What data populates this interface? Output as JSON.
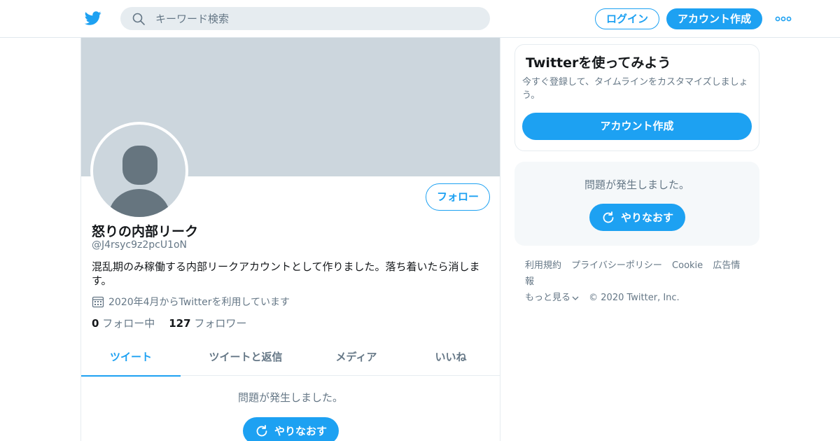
{
  "header": {
    "search_placeholder": "キーワード検索",
    "login_label": "ログイン",
    "signup_label": "アカウント作成",
    "icons": {
      "logo": "twitter-bird-icon",
      "search": "search-icon",
      "more": "more-dots-icon"
    },
    "accent_color": "#1da1f2"
  },
  "profile": {
    "name": "怒りの内部リーク",
    "handle": "@J4rsyc9z2pcU1oN",
    "bio": "混乱期のみ稼働する内部リークアカウントとして作りました。落ち着いたら消します。",
    "joined": "2020年4月からTwitterを利用しています",
    "following_count": "0",
    "following_label": "フォロー中",
    "followers_count": "127",
    "followers_label": "フォロワー",
    "follow_button": "フォロー"
  },
  "tabs": [
    {
      "label": "ツイート",
      "active": true
    },
    {
      "label": "ツイートと返信",
      "active": false
    },
    {
      "label": "メディア",
      "active": false
    },
    {
      "label": "いいね",
      "active": false
    }
  ],
  "main_error": {
    "message": "問題が発生しました。",
    "retry_label": "やりなおす"
  },
  "sidebar": {
    "signup_card": {
      "title": "Twitterを使ってみよう",
      "description": "今すぐ登録して、タイムラインをカスタマイズしましょう。",
      "button": "アカウント作成"
    },
    "error": {
      "message": "問題が発生しました。",
      "retry_label": "やりなおす"
    },
    "footer": {
      "links": [
        "利用規約",
        "プライバシーポリシー",
        "Cookie",
        "広告情報",
        "もっと見る"
      ],
      "copyright": "© 2020 Twitter, Inc."
    }
  }
}
